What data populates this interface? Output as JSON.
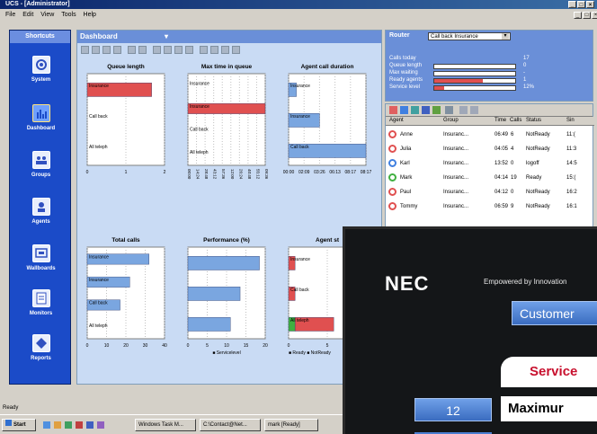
{
  "window": {
    "title": "UCS - [Administrator]",
    "controls": [
      "_",
      "□",
      "×"
    ]
  },
  "menu": {
    "items": [
      "File",
      "Edit",
      "View",
      "Tools",
      "Help"
    ]
  },
  "sidebar": {
    "header": "Shortcuts",
    "items": [
      {
        "label": "System",
        "icon": "system-icon"
      },
      {
        "label": "Dashboard",
        "icon": "dashboard-icon",
        "active": true
      },
      {
        "label": "Groups",
        "icon": "groups-icon"
      },
      {
        "label": "Agents",
        "icon": "agents-icon"
      },
      {
        "label": "Wallboards",
        "icon": "wallboards-icon"
      },
      {
        "label": "Monitors",
        "icon": "monitors-icon"
      },
      {
        "label": "Reports",
        "icon": "reports-icon"
      }
    ]
  },
  "dashboard": {
    "title": "Dashboard"
  },
  "chart_data": [
    {
      "type": "bar",
      "title": "Queue length",
      "categories": [
        "Insurance",
        "Call back",
        "All teleph"
      ],
      "values": [
        2,
        0,
        0
      ],
      "xticks": [
        "0",
        "1",
        "2"
      ],
      "xlim": [
        0,
        2.4
      ],
      "colors": [
        "#e05050",
        "#7aa6e0",
        "#7aa6e0"
      ]
    },
    {
      "type": "bar",
      "title": "Max time in queue",
      "categories": [
        "Insurance",
        "Insurance",
        "Call back",
        "All teleph"
      ],
      "values": [
        0,
        1,
        0,
        0
      ],
      "xticks": [
        "00:00",
        "14:24",
        "28:48",
        "43:12",
        "57:36",
        "12:00",
        "26:24",
        "40:48",
        "55:12",
        "09:36"
      ],
      "xlim": [
        0,
        1
      ],
      "colors": [
        "#7aa6e0",
        "#e05050",
        "#7aa6e0",
        "#7aa6e0"
      ]
    },
    {
      "type": "bar",
      "title": "Agent call duration",
      "categories": [
        "Insurance",
        "Insurance",
        "Call back"
      ],
      "values": [
        0.1,
        0.4,
        1
      ],
      "xticks": [
        "00:00",
        "02:09",
        "03:26",
        "06:13",
        "08:17",
        "08:17"
      ],
      "xlim": [
        0,
        1
      ],
      "colors": [
        "#7aa6e0",
        "#7aa6e0",
        "#7aa6e0"
      ]
    },
    {
      "type": "bar",
      "title": "Total calls",
      "categories": [
        "Insurance",
        "Insurance",
        "Call back",
        "All teleph"
      ],
      "values": [
        32,
        22,
        17,
        0
      ],
      "xticks": [
        "0",
        "10",
        "20",
        "30",
        "40"
      ],
      "xlim": [
        0,
        40
      ],
      "colors": [
        "#7aa6e0",
        "#7aa6e0",
        "#7aa6e0",
        "#7aa6e0"
      ]
    },
    {
      "type": "bar",
      "title": "Performance (%)",
      "categories": [
        "",
        "",
        ""
      ],
      "values": [
        18.5,
        13.5,
        11
      ],
      "xticks": [
        "0",
        "5",
        "10",
        "15",
        "20"
      ],
      "xlim": [
        0,
        20
      ],
      "legend": [
        "Servicelevel"
      ],
      "colors": [
        "#7aa6e0",
        "#7aa6e0",
        "#7aa6e0"
      ]
    },
    {
      "type": "bar",
      "title": "Agent st",
      "categories": [
        "Insurance",
        "Call back",
        "All teleph"
      ],
      "series": [
        {
          "name": "Ready",
          "values": [
            0,
            0,
            1
          ]
        },
        {
          "name": "NotReady",
          "values": [
            1,
            1,
            6
          ]
        }
      ],
      "xticks": [
        "0",
        "5",
        "10"
      ],
      "xlim": [
        0,
        12
      ],
      "colors": [
        "#40b040",
        "#e05050"
      ]
    }
  ],
  "router": {
    "label": "Router",
    "selected": "Call back Insurance",
    "stats": [
      {
        "label": "Calls today",
        "value": "17"
      },
      {
        "label": "Queue length",
        "value": "0"
      },
      {
        "label": "Max waiting",
        "value": "-"
      },
      {
        "label": "Ready agents",
        "value": "1"
      },
      {
        "label": "Service level",
        "value": "12%"
      }
    ],
    "ready_fill": 0.6,
    "service_fill": 0.12
  },
  "agents": {
    "columns": [
      "Agent",
      "Group",
      "Time",
      "Calls",
      "Status",
      "Sin"
    ],
    "rows": [
      {
        "name": "Anne",
        "group": "Insuranc...",
        "time": "06:49",
        "calls": "6",
        "status": "NotReady",
        "since": "11:(",
        "icon": "notready"
      },
      {
        "name": "Julia",
        "group": "Insuranc...",
        "time": "04:05",
        "calls": "4",
        "status": "NotReady",
        "since": "11:3",
        "icon": "notready"
      },
      {
        "name": "Karl",
        "group": "Insuranc...",
        "time": "13:52",
        "calls": "0",
        "status": "logoff",
        "since": "14:5",
        "icon": "logoff"
      },
      {
        "name": "Mark",
        "group": "Insuranc...",
        "time": "04:14",
        "calls": "19",
        "status": "Ready",
        "since": "15:(",
        "icon": "ready"
      },
      {
        "name": "Paul",
        "group": "Insuranc...",
        "time": "04:12",
        "calls": "0",
        "status": "NotReady",
        "since": "16:2",
        "icon": "notready"
      },
      {
        "name": "Tommy",
        "group": "Insuranc...",
        "time": "06:59",
        "calls": "9",
        "status": "NotReady",
        "since": "16:1",
        "icon": "notready"
      }
    ]
  },
  "statusbar": {
    "text": "Ready"
  },
  "taskbar": {
    "start": "Start",
    "tasks": [
      "Windows Task M...",
      "C:\\Contact@Net...",
      "mark [Ready]"
    ]
  },
  "nec": {
    "logo": "NEC",
    "tagline": "Empowered by Innovation",
    "customer": "Customer",
    "service": "Service",
    "number": "12",
    "maximum": "Maximur"
  },
  "colors": {
    "sidebar": "#1b4bc8",
    "panel": "#c9dbf4",
    "bar_blue": "#7aa6e0",
    "bar_red": "#e05050"
  }
}
